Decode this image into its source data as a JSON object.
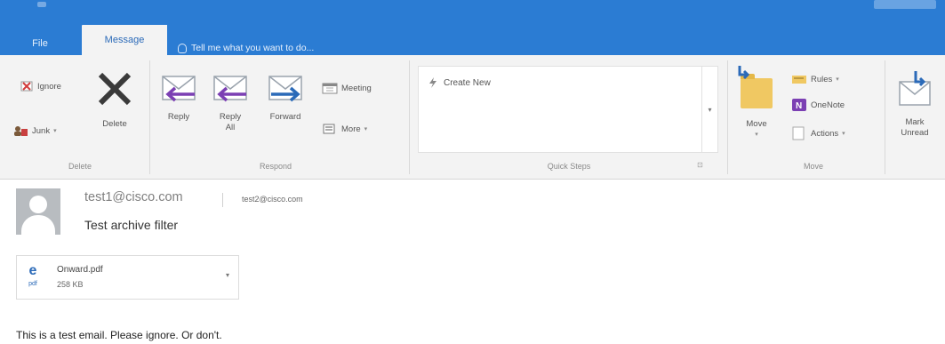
{
  "tabs": {
    "file": "File",
    "message": "Message",
    "tell_me": "Tell me what you want to do..."
  },
  "ribbon": {
    "delete_group": {
      "ignore": "Ignore",
      "junk": "Junk",
      "delete": "Delete",
      "label": "Delete"
    },
    "respond_group": {
      "reply": "Reply",
      "reply_all_line1": "Reply",
      "reply_all_line2": "All",
      "forward": "Forward",
      "meeting": "Meeting",
      "more": "More",
      "label": "Respond"
    },
    "quick_steps_group": {
      "create_new": "Create New",
      "label": "Quick Steps"
    },
    "move_group": {
      "move": "Move",
      "rules": "Rules",
      "onenote": "OneNote",
      "actions": "Actions",
      "label": "Move"
    },
    "tags_group": {
      "mark_unread_line1": "Mark",
      "mark_unread_line2": "Unread"
    }
  },
  "message": {
    "sender": "test1@cisco.com",
    "recipient": "test2@cisco.com",
    "subject": "Test archive filter",
    "body": "This is a test email. Please ignore. Or don't."
  },
  "attachment": {
    "filename": "Onward.pdf",
    "size": "258 KB",
    "ext": "pdf"
  },
  "icons": {
    "reply_arrow_color": "#7b3fb3",
    "forward_arrow_color": "#2b6ab8",
    "delete_x_color": "#3a3a3a"
  }
}
